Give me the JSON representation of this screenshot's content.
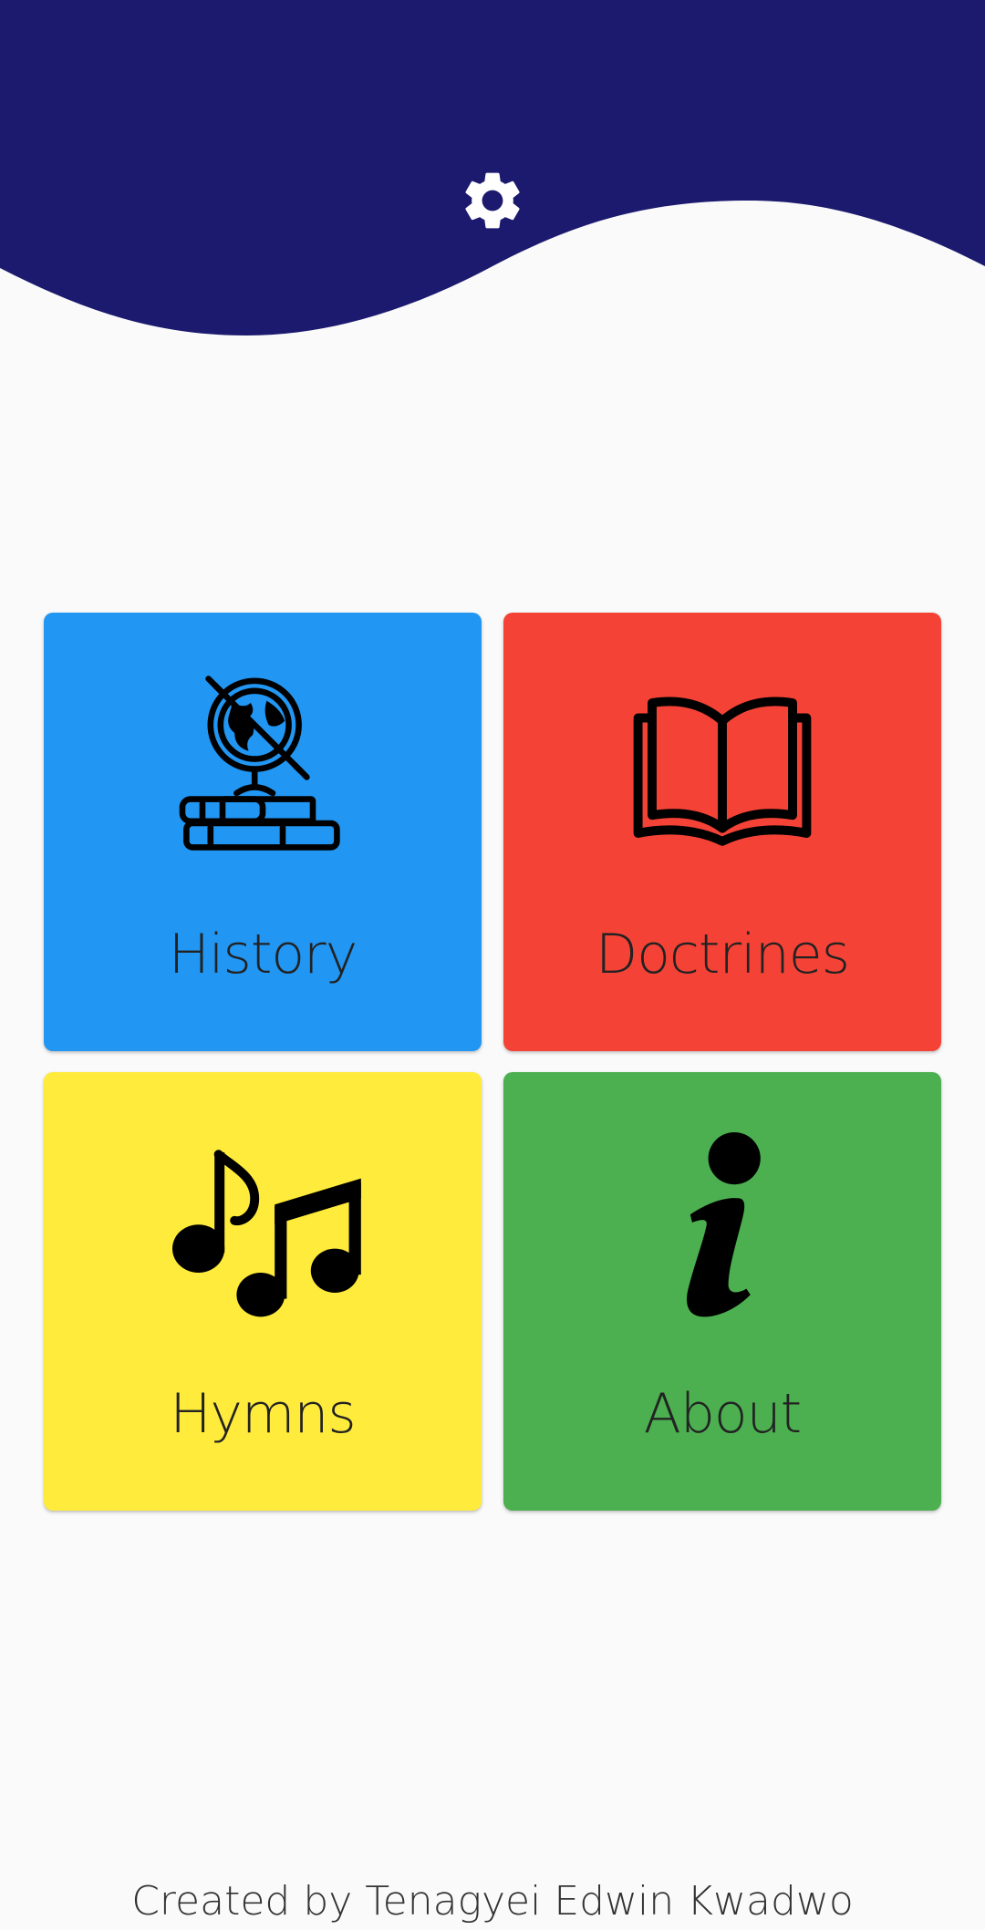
{
  "colors": {
    "header": "#1b1a6e",
    "background": "#fafafa",
    "history": "#2196f3",
    "doctrines": "#f44336",
    "hymns": "#ffeb3b",
    "about": "#4caf50"
  },
  "header": {
    "settings_icon": "gear-icon"
  },
  "tiles": [
    {
      "label": "History",
      "icon": "globe-on-books-icon"
    },
    {
      "label": "Doctrines",
      "icon": "open-book-icon"
    },
    {
      "label": "Hymns",
      "icon": "music-notes-icon"
    },
    {
      "label": "About",
      "icon": "info-icon"
    }
  ],
  "footer": {
    "credit": "Created by Tenagyei Edwin Kwadwo"
  }
}
